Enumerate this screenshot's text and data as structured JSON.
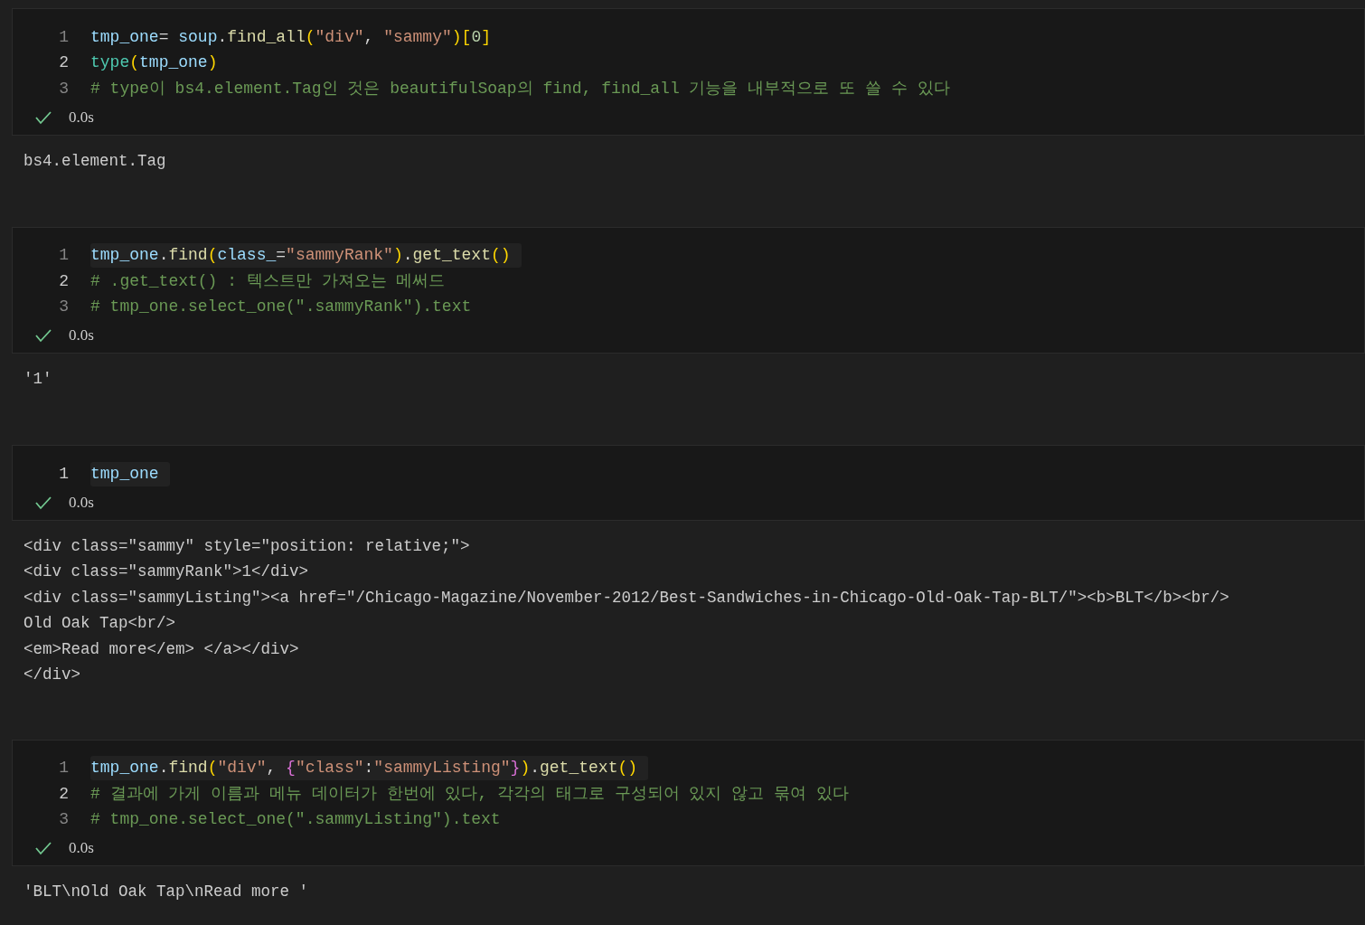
{
  "cells": [
    {
      "lines": [
        {
          "number": "1",
          "current": false,
          "highlighted": false,
          "tokens": [
            {
              "t": "tmp_one",
              "color": "#9cdcfe"
            },
            {
              "t": "= ",
              "color": "#d4d4d4"
            },
            {
              "t": "soup",
              "color": "#9cdcfe"
            },
            {
              "t": ".",
              "color": "#d4d4d4"
            },
            {
              "t": "find_all",
              "color": "#dcdcaa"
            },
            {
              "t": "(",
              "color": "#ffd700"
            },
            {
              "t": "\"div\"",
              "color": "#ce9178"
            },
            {
              "t": ", ",
              "color": "#d4d4d4"
            },
            {
              "t": "\"sammy\"",
              "color": "#ce9178"
            },
            {
              "t": ")",
              "color": "#ffd700"
            },
            {
              "t": "[",
              "color": "#ffd700"
            },
            {
              "t": "0",
              "color": "#b5cea8"
            },
            {
              "t": "]",
              "color": "#ffd700"
            }
          ]
        },
        {
          "number": "2",
          "current": true,
          "highlighted": false,
          "tokens": [
            {
              "t": "type",
              "color": "#4ec9b0"
            },
            {
              "t": "(",
              "color": "#ffd700"
            },
            {
              "t": "tmp_one",
              "color": "#9cdcfe"
            },
            {
              "t": ")",
              "color": "#ffd700"
            }
          ]
        },
        {
          "number": "3",
          "current": false,
          "highlighted": false,
          "tokens": [
            {
              "t": "# type이 bs4.element.Tag인 것은 beautifulSoap의 find, find_all 기능을 내부적으로 또 쓸 수 있다",
              "color": "#6a9955"
            }
          ]
        }
      ],
      "success": true,
      "time": "0.0s",
      "output": [
        "bs4.element.Tag"
      ]
    },
    {
      "lines": [
        {
          "number": "1",
          "current": false,
          "highlighted": true,
          "tokens": [
            {
              "t": "tmp_one",
              "color": "#9cdcfe"
            },
            {
              "t": "."
            },
            {
              "t": "find",
              "color": "#dcdcaa"
            },
            {
              "t": "(",
              "color": "#ffd700"
            },
            {
              "t": "class_",
              "color": "#9cdcfe"
            },
            {
              "t": "=",
              "color": "#d4d4d4"
            },
            {
              "t": "\"sammyRank\"",
              "color": "#ce9178"
            },
            {
              "t": ")",
              "color": "#ffd700"
            },
            {
              "t": "."
            },
            {
              "t": "get_text",
              "color": "#dcdcaa"
            },
            {
              "t": "()",
              "color": "#ffd700"
            }
          ]
        },
        {
          "number": "2",
          "current": true,
          "highlighted": false,
          "tokens": [
            {
              "t": "# .get_text() : 텍스트만 가져오는 메써드",
              "color": "#6a9955"
            }
          ]
        },
        {
          "number": "3",
          "current": false,
          "highlighted": false,
          "tokens": [
            {
              "t": "# tmp_one.select_one(\".sammyRank\").text",
              "color": "#6a9955"
            }
          ]
        }
      ],
      "success": true,
      "time": "0.0s",
      "output": [
        "'1'"
      ]
    },
    {
      "lines": [
        {
          "number": "1",
          "current": true,
          "highlighted": true,
          "tokens": [
            {
              "t": "tmp_one",
              "color": "#9cdcfe"
            }
          ]
        }
      ],
      "success": true,
      "time": "0.0s",
      "output": [
        "<div class=\"sammy\" style=\"position: relative;\">",
        "<div class=\"sammyRank\">1</div>",
        "<div class=\"sammyListing\"><a href=\"/Chicago-Magazine/November-2012/Best-Sandwiches-in-Chicago-Old-Oak-Tap-BLT/\"><b>BLT</b><br/>",
        "Old Oak Tap<br/>",
        "<em>Read more</em> </a></div>",
        "</div>"
      ]
    },
    {
      "lines": [
        {
          "number": "1",
          "current": false,
          "highlighted": true,
          "tokens": [
            {
              "t": "tmp_one",
              "color": "#9cdcfe"
            },
            {
              "t": "."
            },
            {
              "t": "find",
              "color": "#dcdcaa"
            },
            {
              "t": "(",
              "color": "#ffd700"
            },
            {
              "t": "\"div\"",
              "color": "#ce9178"
            },
            {
              "t": ", ",
              "color": "#d4d4d4"
            },
            {
              "t": "{",
              "color": "#da70d6"
            },
            {
              "t": "\"class\"",
              "color": "#ce9178"
            },
            {
              "t": ":",
              "color": "#d4d4d4"
            },
            {
              "t": "\"sammyListing\"",
              "color": "#ce9178"
            },
            {
              "t": "}",
              "color": "#da70d6"
            },
            {
              "t": ")",
              "color": "#ffd700"
            },
            {
              "t": "."
            },
            {
              "t": "get_text",
              "color": "#dcdcaa"
            },
            {
              "t": "()",
              "color": "#ffd700"
            }
          ]
        },
        {
          "number": "2",
          "current": true,
          "highlighted": false,
          "tokens": [
            {
              "t": "# 결과에 가게 이름과 메뉴 데이터가 한번에 있다, 각각의 태그로 구성되어 있지 않고 묶여 있다",
              "color": "#6a9955"
            }
          ]
        },
        {
          "number": "3",
          "current": false,
          "highlighted": false,
          "tokens": [
            {
              "t": "# tmp_one.select_one(\".sammyListing\").text",
              "color": "#6a9955"
            }
          ]
        }
      ],
      "success": true,
      "time": "0.0s",
      "output": [
        "'BLT\\nOld Oak Tap\\nRead more '"
      ]
    }
  ]
}
